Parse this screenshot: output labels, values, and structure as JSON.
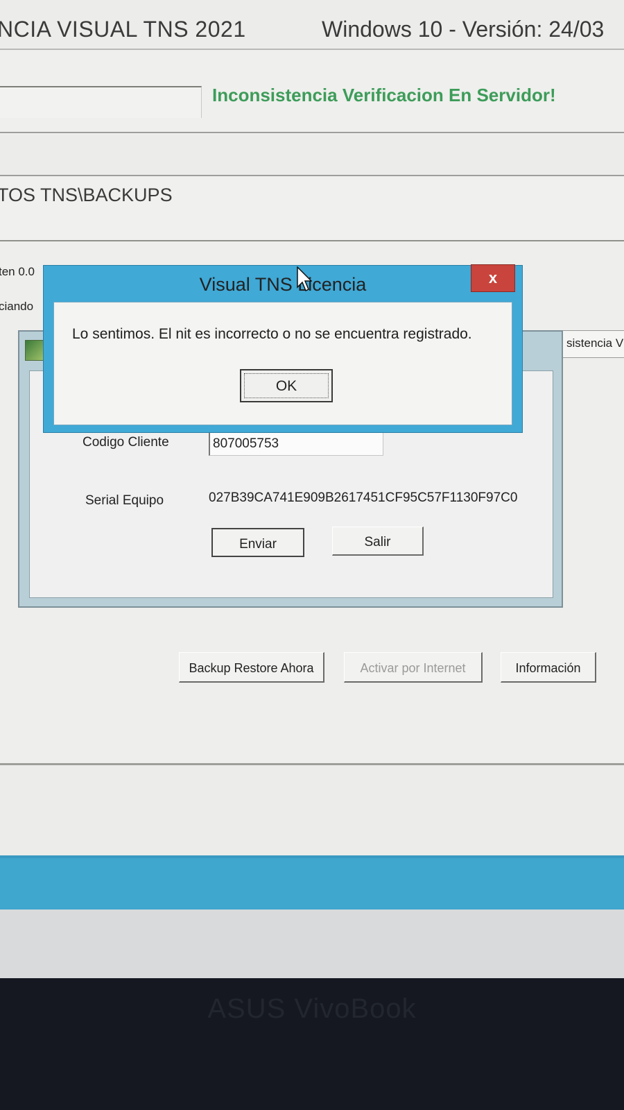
{
  "window": {
    "title": "NCIA VISUAL TNS 2021",
    "os_version": "Windows 10 - Versión: 24/03"
  },
  "status": {
    "message": "Inconsistencia Verificacion En Servidor!",
    "color": "#3d9c59"
  },
  "backup_path": "TOS TNS\\BACKUPS",
  "fragments": {
    "left_1": "ten 0.0",
    "left_2": "ciando",
    "right_1": "sistencia V"
  },
  "license_window": {
    "icon": "visual-tns-app-icon",
    "client_code_label": "Codigo Cliente",
    "client_code_value": "807005753",
    "serial_label": "Serial Equipo",
    "serial_value": "027B39CA741E909B2617451CF95C57F1130F97C0",
    "send_button": "Enviar",
    "exit_button": "Salir"
  },
  "dialog": {
    "title": "Visual TNS Licencia",
    "close_glyph": "x",
    "message": "Lo sentimos. El nit es incorrecto o no se encuentra registrado.",
    "ok_button": "OK",
    "title_color": "#40a9d6",
    "close_color": "#c8443c"
  },
  "actions": {
    "backup_restore": "Backup Restore Ahora",
    "activate_internet": "Activar por Internet",
    "information": "Información"
  },
  "device": {
    "brand": "ASUS VivoBook"
  }
}
